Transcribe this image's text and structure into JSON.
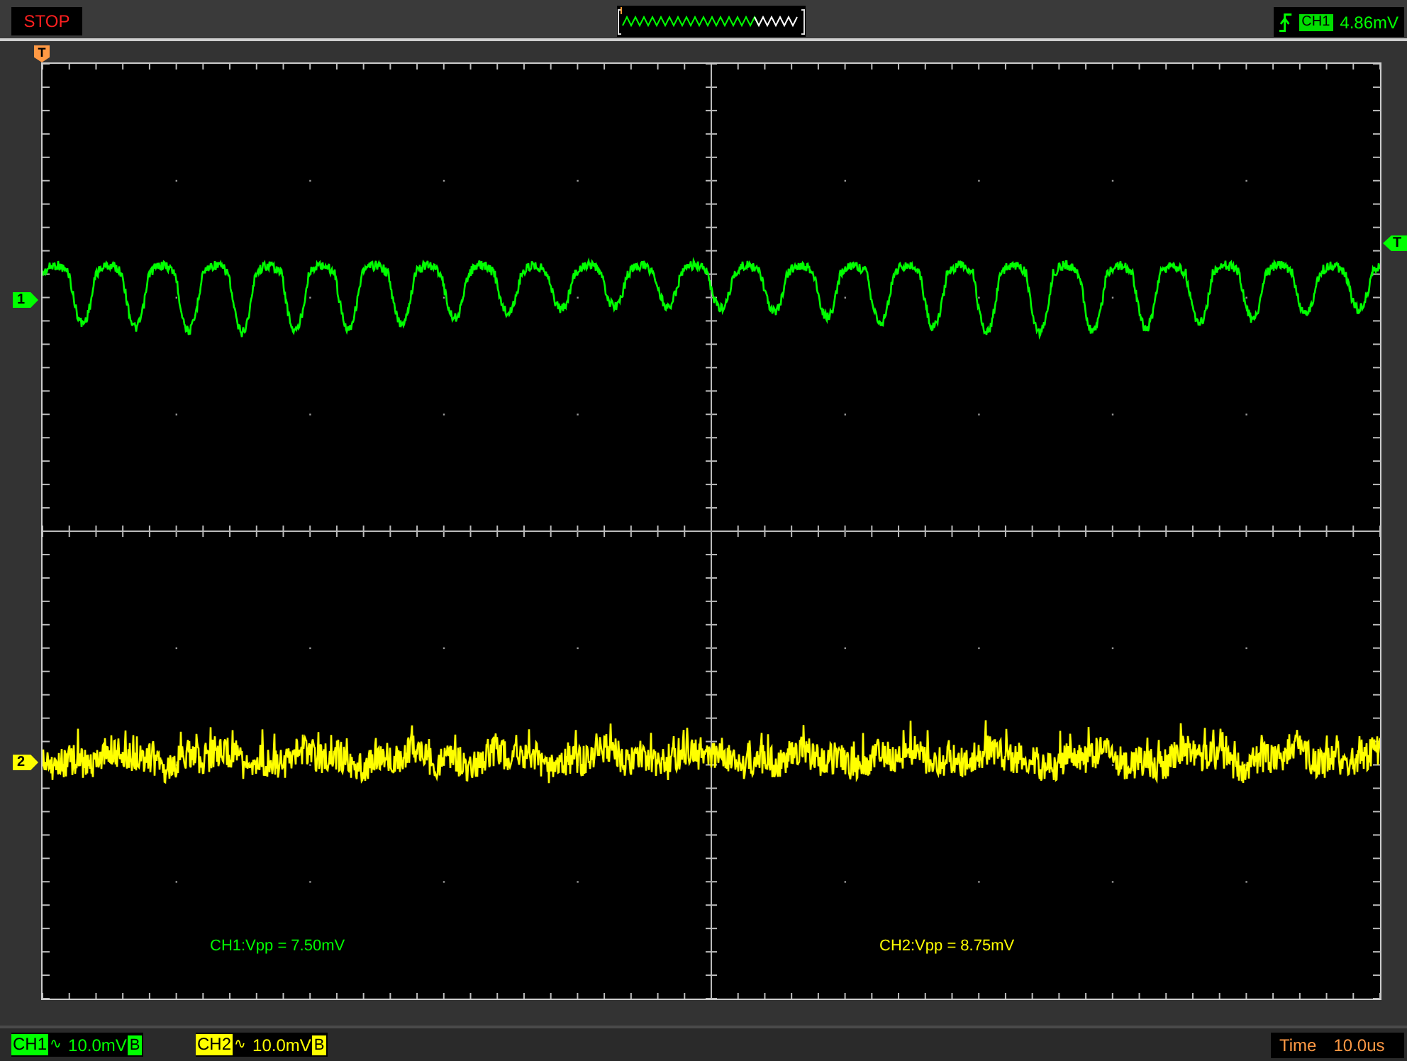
{
  "status": "STOP",
  "trigger": {
    "channel": "CH1",
    "level": "4.86mV",
    "marker": "T",
    "position_marker": "T"
  },
  "channel_markers": [
    {
      "label": "1",
      "color": "#00ff00"
    },
    {
      "label": "2",
      "color": "#ffff00"
    }
  ],
  "measurements": [
    {
      "text": "CH1:Vpp = 7.50mV",
      "color": "#00ff00"
    },
    {
      "text": "CH2:Vpp = 8.75mV",
      "color": "#ffff00"
    }
  ],
  "channels": [
    {
      "label": "CH1",
      "coupling": "∿",
      "scale": "10.0mV",
      "bandwidth": "B",
      "color": "#00ff00"
    },
    {
      "label": "CH2",
      "coupling": "∿",
      "scale": "10.0mV",
      "bandwidth": "B",
      "color": "#ffff00"
    }
  ],
  "timebase": {
    "label": "Time",
    "value": "10.0us"
  }
}
